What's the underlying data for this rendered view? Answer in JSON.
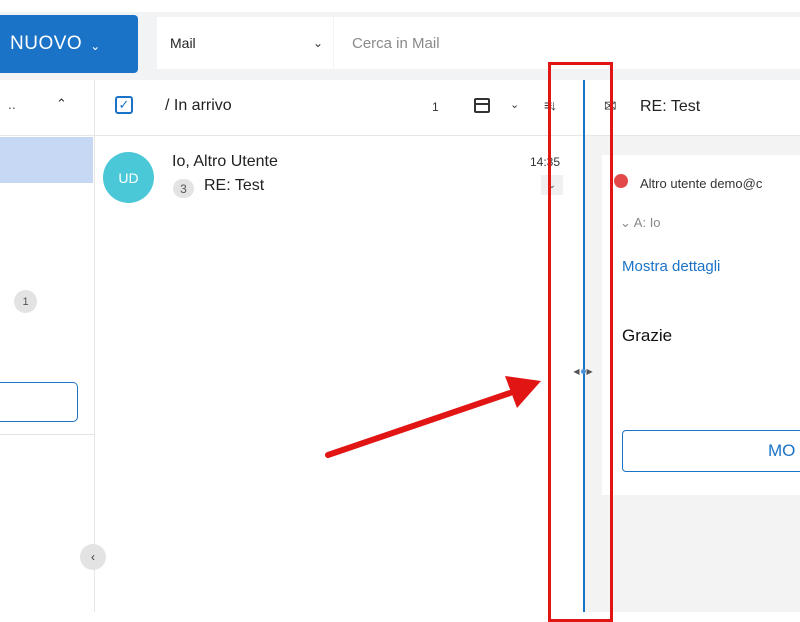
{
  "header": {
    "new_button": "NUOVO",
    "search_scope": "Mail",
    "search_placeholder": "Cerca in Mail"
  },
  "sidebar": {
    "truncated_label": "..",
    "badge_count": "1"
  },
  "list": {
    "folder_title": "/ In arrivo",
    "count": "1",
    "messages": [
      {
        "avatar_initials": "UD",
        "from": "Io, Altro Utente",
        "thread_count": "3",
        "subject": "RE: Test",
        "time": "14:35"
      }
    ]
  },
  "reading_pane": {
    "subject": "RE: Test",
    "sender": "Altro utente  demo@c",
    "to": "A: Io",
    "details_link": "Mostra dettagli",
    "body": "Grazie",
    "more_button": "MO"
  },
  "colors": {
    "accent": "#1a73c7",
    "avatar": "#4bc8d8",
    "annotation": "#e21515"
  }
}
